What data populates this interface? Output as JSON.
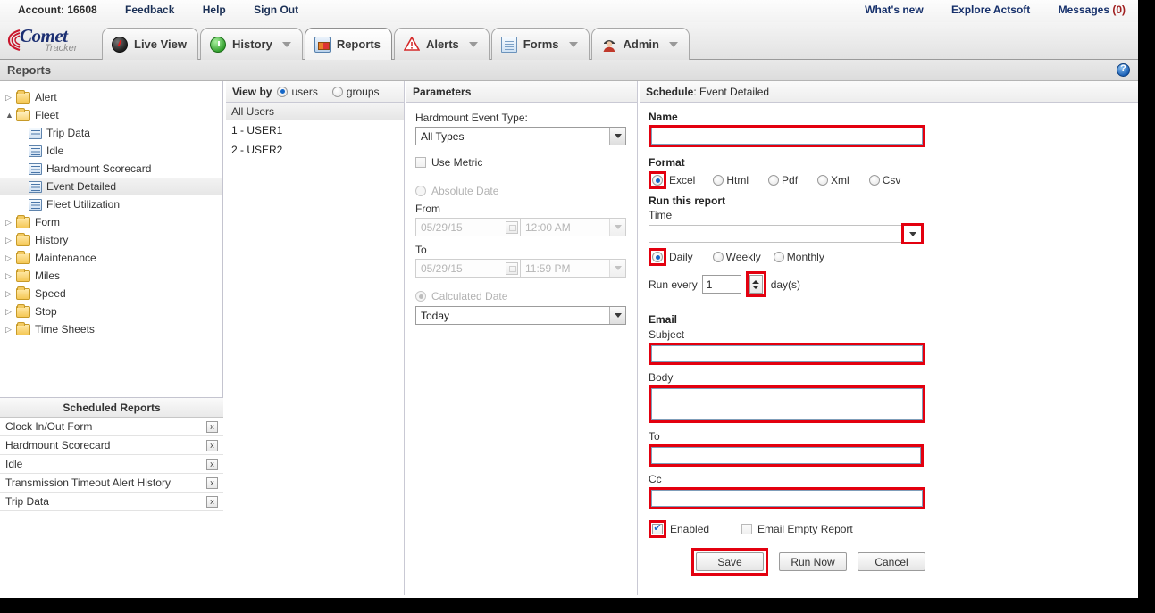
{
  "utility_bar": {
    "left_links": [
      {
        "label": "Account: 16608",
        "name": "account-link"
      },
      {
        "label": "Feedback",
        "name": "feedback-link"
      },
      {
        "label": "Help",
        "name": "help-link"
      },
      {
        "label": "Sign Out",
        "name": "sign-out-link"
      }
    ],
    "right_links": [
      {
        "label": "What's new",
        "name": "whats-new-link"
      },
      {
        "label": "Explore Actsoft",
        "name": "explore-actsoft-link"
      }
    ],
    "messages": {
      "label": "Messages ",
      "count": "(0)"
    }
  },
  "logo": {
    "primary": "Comet",
    "secondary": "Tracker"
  },
  "tabs": [
    {
      "label": "Live View",
      "icon": "gauge-icon",
      "active": false,
      "caret": false
    },
    {
      "label": "History",
      "icon": "clock-icon",
      "active": false,
      "caret": true
    },
    {
      "label": "Reports",
      "icon": "report-icon",
      "active": true,
      "caret": false
    },
    {
      "label": "Alerts",
      "icon": "warning-triangle-icon",
      "active": false,
      "caret": true
    },
    {
      "label": "Forms",
      "icon": "document-icon",
      "active": false,
      "caret": true
    },
    {
      "label": "Admin",
      "icon": "user-admin-icon",
      "active": false,
      "caret": true
    }
  ],
  "page": {
    "title": "Reports",
    "help_icon": "help-question-icon"
  },
  "tree": {
    "nodes": [
      {
        "label": "Alert",
        "type": "folder",
        "expanded": false,
        "selected": false
      },
      {
        "label": "Fleet",
        "type": "folder",
        "expanded": true,
        "selected": false
      },
      {
        "label": "Trip Data",
        "type": "report",
        "child": true,
        "selected": false
      },
      {
        "label": "Idle",
        "type": "report",
        "child": true,
        "selected": false
      },
      {
        "label": "Hardmount Scorecard",
        "type": "report",
        "child": true,
        "selected": false
      },
      {
        "label": "Event Detailed",
        "type": "report",
        "child": true,
        "selected": true
      },
      {
        "label": "Fleet Utilization",
        "type": "report",
        "child": true,
        "selected": false
      },
      {
        "label": "Form",
        "type": "folder",
        "expanded": false,
        "selected": false
      },
      {
        "label": "History",
        "type": "folder",
        "expanded": false,
        "selected": false
      },
      {
        "label": "Maintenance",
        "type": "folder",
        "expanded": false,
        "selected": false
      },
      {
        "label": "Miles",
        "type": "folder",
        "expanded": false,
        "selected": false
      },
      {
        "label": "Speed",
        "type": "folder",
        "expanded": false,
        "selected": false
      },
      {
        "label": "Stop",
        "type": "folder",
        "expanded": false,
        "selected": false
      },
      {
        "label": "Time Sheets",
        "type": "folder",
        "expanded": false,
        "selected": false
      }
    ]
  },
  "scheduled_reports": {
    "title": "Scheduled Reports",
    "delete_glyph": "x",
    "rows": [
      {
        "label": "Clock In/Out Form"
      },
      {
        "label": "Hardmount Scorecard"
      },
      {
        "label": "Idle"
      },
      {
        "label": "Transmission Timeout Alert History"
      },
      {
        "label": "Trip Data"
      }
    ]
  },
  "view_by": {
    "label": "View by",
    "options": [
      {
        "label": "users",
        "selected": true
      },
      {
        "label": "groups",
        "selected": false
      }
    ],
    "list_header": "All Users",
    "users": [
      {
        "label": "1 - USER1"
      },
      {
        "label": "2 - USER2"
      }
    ]
  },
  "parameters": {
    "title": "Parameters",
    "event_type": {
      "label": "Hardmount Event Type:",
      "value": "All Types"
    },
    "use_metric": {
      "label": "Use Metric",
      "checked": false
    },
    "absolute_date": {
      "label": "Absolute Date",
      "selected": false,
      "disabled": true
    },
    "from": {
      "label": "From",
      "date": "05/29/15",
      "time": "12:00 AM"
    },
    "to": {
      "label": "To",
      "date": "05/29/15",
      "time": "11:59 PM"
    },
    "calculated_date": {
      "label": "Calculated Date",
      "selected": true,
      "disabled": true
    },
    "calculated_value": "Today"
  },
  "schedule": {
    "title_label": "Schedule",
    "title_value": ": Event Detailed",
    "name": {
      "label": "Name",
      "value": ""
    },
    "format": {
      "label": "Format",
      "options": [
        {
          "label": "Excel",
          "selected": true,
          "highlighted": true
        },
        {
          "label": "Html",
          "selected": false,
          "highlighted": false
        },
        {
          "label": "Pdf",
          "selected": false,
          "highlighted": false
        },
        {
          "label": "Xml",
          "selected": false,
          "highlighted": false
        },
        {
          "label": "Csv",
          "selected": false,
          "highlighted": false
        }
      ]
    },
    "run_this_report": {
      "label": "Run this report",
      "time_label": "Time",
      "time_value": "",
      "frequency": [
        {
          "label": "Daily",
          "selected": true,
          "highlighted": true
        },
        {
          "label": "Weekly",
          "selected": false,
          "highlighted": false
        },
        {
          "label": "Monthly",
          "selected": false,
          "highlighted": false
        }
      ],
      "run_every_prefix": "Run every",
      "run_every_value": "1",
      "run_every_suffix": "day(s)"
    },
    "email": {
      "section_label": "Email",
      "subject_label": "Subject",
      "subject_value": "",
      "body_label": "Body",
      "body_value": "",
      "to_label": "To",
      "to_value": "",
      "cc_label": "Cc",
      "cc_value": "",
      "enabled": {
        "label": "Enabled",
        "checked": true,
        "highlighted": true
      },
      "email_empty_report": {
        "label": "Email Empty Report",
        "checked": false
      }
    },
    "buttons": [
      {
        "label": "Save",
        "highlighted": true,
        "name": "save-button"
      },
      {
        "label": "Run Now",
        "highlighted": false,
        "name": "run-now-button"
      },
      {
        "label": "Cancel",
        "highlighted": false,
        "name": "cancel-button"
      }
    ]
  },
  "colors": {
    "highlight": "#e3000f",
    "accent": "#1567c8",
    "logo_blue": "#1c2f72"
  }
}
